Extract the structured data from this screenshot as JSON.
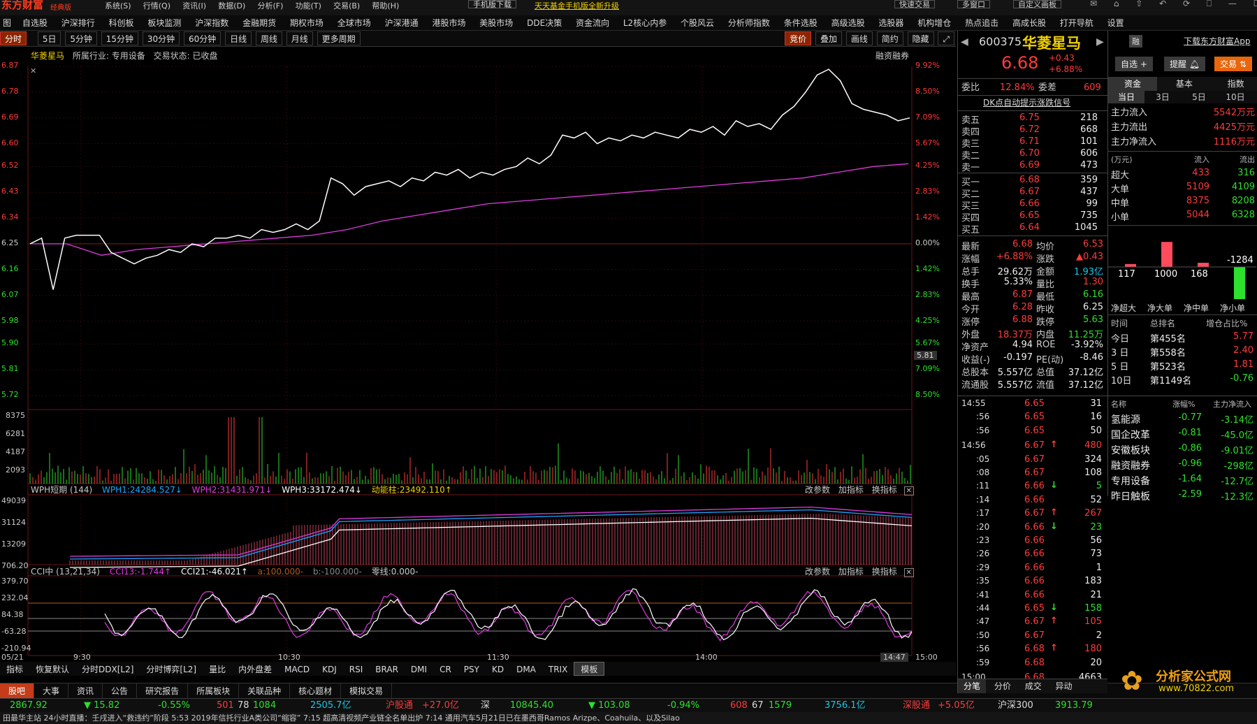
{
  "app": {
    "brand": "东方财富",
    "edition": "经典版",
    "menus": [
      "系统(S)",
      "行情(Q)",
      "资讯(I)",
      "数据(D)",
      "分析(F)",
      "功能(T)",
      "交易(B)",
      "帮助(H)"
    ],
    "promo1": "手机版下载",
    "promo2": "天天基金手机版全新升级",
    "right_items": [
      "快速交易",
      "多窗口",
      "自定义画板"
    ]
  },
  "nav": [
    "图",
    "自选股",
    "沪深排行",
    "科创板",
    "板块监测",
    "沪深指数",
    "金融期货",
    "期权市场",
    "全球市场",
    "沪深港通",
    "港股市场",
    "美股市场",
    "DDE决策",
    "资金流向",
    "L2核心内参",
    "个股风云",
    "分析师指数",
    "条件选股",
    "高级选股",
    "选股器",
    "机构增仓",
    "热点追击",
    "高成长股",
    "打开导航",
    "设置"
  ],
  "periods": [
    "分时",
    "5日",
    "5分钟",
    "15分钟",
    "30分钟",
    "60分钟",
    "日线",
    "周线",
    "月线",
    "更多周期"
  ],
  "chart_tools": [
    "竞价",
    "叠加",
    "画线",
    "简约",
    "隐藏"
  ],
  "stock_header": {
    "name": "华菱星马",
    "industry_label": "所属行业:",
    "industry": "专用设备",
    "state_label": "交易状态:",
    "state": "已收盘",
    "tag": "融资融券"
  },
  "axis": {
    "left": [
      "6.87",
      "6.78",
      "6.69",
      "6.60",
      "6.52",
      "6.43",
      "6.34",
      "6.25",
      "6.16",
      "6.07",
      "5.98",
      "5.90",
      "5.81",
      "5.72"
    ],
    "right": [
      "9.92%",
      "8.50%",
      "7.09%",
      "5.67%",
      "4.25%",
      "2.83%",
      "1.42%",
      "0.00%",
      "1.42%",
      "2.83%",
      "4.25%",
      "5.67%",
      "7.09%",
      "8.50%"
    ],
    "cursor_label": "5.81",
    "vol": [
      "8375",
      "6281",
      "4187",
      "2093"
    ],
    "wph": [
      "49039",
      "31124",
      "13209",
      "706.20"
    ],
    "cci": [
      "379.70",
      "232.04",
      "84.38",
      "-63.28",
      "-210.94"
    ],
    "time": [
      "05/21",
      "9:30",
      "10:30",
      "11:30",
      "14:00",
      "14:47",
      "15:00"
    ]
  },
  "wph": {
    "title": "WPH短期 (144)",
    "v1": "WPH1:24284.527↓",
    "v2": "WPH2:31431.971↓",
    "v3": "WPH3:33172.474↓",
    "v4": "动能柱:23492.110↑",
    "tools": [
      "改参数",
      "加指标",
      "换指标"
    ]
  },
  "cci": {
    "title": "CCI中 (13,21,34)",
    "v1": "CCI13:-1.744↑",
    "v2": "CCI21:-46.021↑",
    "v3": "a:100.000-",
    "v4": "b:-100.000-",
    "v5": "零线:0.000-",
    "tools": [
      "改参数",
      "加指标",
      "换指标"
    ]
  },
  "indicator_tabs": [
    "指标",
    "恢复默认",
    "分时DDX[L2]",
    "分时博弈[L2]",
    "量比",
    "内外盘差",
    "MACD",
    "KDJ",
    "RSI",
    "BRAR",
    "DMI",
    "CR",
    "PSY",
    "KD",
    "DMA",
    "TRIX",
    "模板"
  ],
  "bottom_tabs": [
    "股吧",
    "大事",
    "资讯",
    "公告",
    "研究报告",
    "所属板块",
    "关联品种",
    "核心题材",
    "模拟交易"
  ],
  "quote": {
    "code": "600375",
    "name": "华菱星马",
    "price": "6.68",
    "change": "+0.43",
    "pct": "+6.88%",
    "btn_watch": "自选 +",
    "btn_alert": "提醒",
    "btn_trade": "交易",
    "ratio_label": "委比",
    "ratio": "12.84%",
    "diff_label": "委差",
    "diff": "609",
    "signal": "DK点自动提示涨跌信号"
  },
  "order_book": {
    "sell": [
      [
        "卖五",
        "6.75",
        "218"
      ],
      [
        "卖四",
        "6.72",
        "668"
      ],
      [
        "卖三",
        "6.71",
        "101"
      ],
      [
        "卖二",
        "6.70",
        "606"
      ],
      [
        "卖一",
        "6.69",
        "473"
      ]
    ],
    "buy": [
      [
        "买一",
        "6.68",
        "359"
      ],
      [
        "买二",
        "6.67",
        "437"
      ],
      [
        "买三",
        "6.66",
        "99"
      ],
      [
        "买四",
        "6.65",
        "735"
      ],
      [
        "买五",
        "6.64",
        "1045"
      ]
    ]
  },
  "stats": [
    [
      "最新",
      "6.68",
      "均价",
      "6.53"
    ],
    [
      "涨幅",
      "+6.88%",
      "涨跌",
      "▲0.43"
    ],
    [
      "总手",
      "29.62万",
      "金额",
      "1.93亿"
    ],
    [
      "换手",
      "5.33%",
      "量比",
      "1.30"
    ],
    [
      "最高",
      "6.87",
      "最低",
      "6.16"
    ],
    [
      "今开",
      "6.28",
      "昨收",
      "6.25"
    ],
    [
      "涨停",
      "6.88",
      "跌停",
      "5.63"
    ],
    [
      "外盘",
      "18.37万",
      "内盘",
      "11.25万"
    ],
    [
      "净资产",
      "4.94",
      "ROE",
      "-3.92%"
    ],
    [
      "收益(-)",
      "-0.197",
      "PE(动)",
      "-8.46"
    ],
    [
      "总股本",
      "5.557亿",
      "总值",
      "37.12亿"
    ],
    [
      "流通股",
      "5.557亿",
      "流值",
      "37.12亿"
    ]
  ],
  "ticks": [
    [
      "14:55",
      "6.65",
      "31",
      ""
    ],
    [
      ":56",
      "6.65",
      "16",
      ""
    ],
    [
      ":56",
      "6.65",
      "50",
      ""
    ],
    [
      "14:56",
      "6.67",
      "480",
      "up"
    ],
    [
      ":05",
      "6.67",
      "324",
      ""
    ],
    [
      ":08",
      "6.67",
      "108",
      ""
    ],
    [
      ":11",
      "6.66",
      "5",
      "down"
    ],
    [
      ":14",
      "6.66",
      "52",
      ""
    ],
    [
      ":17",
      "6.67",
      "267",
      "up"
    ],
    [
      ":20",
      "6.66",
      "23",
      "down"
    ],
    [
      ":23",
      "6.66",
      "56",
      ""
    ],
    [
      ":26",
      "6.66",
      "73",
      ""
    ],
    [
      ":29",
      "6.66",
      "1",
      ""
    ],
    [
      ":35",
      "6.66",
      "183",
      ""
    ],
    [
      ":41",
      "6.66",
      "21",
      ""
    ],
    [
      ":44",
      "6.65",
      "158",
      "down"
    ],
    [
      ":47",
      "6.67",
      "105",
      "up"
    ],
    [
      ":50",
      "6.67",
      "2",
      ""
    ],
    [
      ":56",
      "6.68",
      "180",
      "up"
    ],
    [
      ":59",
      "6.68",
      "20",
      ""
    ],
    [
      "15:00",
      "6.68",
      "4663",
      ""
    ]
  ],
  "right_bottom_tabs": [
    "分笔",
    "分价",
    "成交",
    "异动"
  ],
  "fund": {
    "tabs": [
      "资金",
      "基本",
      "指数"
    ],
    "subtabs": [
      "当日",
      "3日",
      "5日",
      "10日"
    ],
    "flows": [
      [
        "主力流入",
        "5542万元"
      ],
      [
        "主力流出",
        "4425万元"
      ],
      [
        "主力净流入",
        "1116万元"
      ]
    ],
    "table_head": [
      "(万元)",
      "流入",
      "流出"
    ],
    "table": [
      [
        "超大",
        "433",
        "316"
      ],
      [
        "大单",
        "5109",
        "4109"
      ],
      [
        "中单",
        "8375",
        "8208"
      ],
      [
        "小单",
        "5044",
        "6328"
      ]
    ],
    "net_values": [
      "117",
      "1000",
      "168",
      "-1284"
    ],
    "net_labels": [
      "净超大",
      "净大单",
      "净中单",
      "净小单"
    ],
    "rank_head": [
      "时间",
      "总排名",
      "增仓占比%"
    ],
    "rank": [
      [
        "今日",
        "第455名",
        "5.77"
      ],
      [
        "3 日",
        "第558名",
        "2.40"
      ],
      [
        "5 日",
        "第523名",
        "1.81"
      ],
      [
        "10日",
        "第1149名",
        "-0.76"
      ]
    ],
    "sector_head": [
      "名称",
      "涨幅%",
      "主力净流入"
    ],
    "sectors": [
      [
        "氢能源",
        "-0.77",
        "-3.14亿"
      ],
      [
        "国企改革",
        "-0.81",
        "-45.0亿"
      ],
      [
        "安徽板块",
        "-0.86",
        "-9.01亿"
      ],
      [
        "融资融券",
        "-0.96",
        "-298亿"
      ],
      [
        "专用设备",
        "-1.64",
        "-12.7亿"
      ],
      [
        "昨日触板",
        "-2.59",
        "-12.3亿"
      ]
    ]
  },
  "top_right": {
    "download": "下载东方财富App",
    "badge": "融"
  },
  "status": {
    "idx1": "2867.92",
    "idx1_chg": "▼ 15.82",
    "idx1_pct": "-0.55%",
    "up": "501",
    "flat": "78",
    "down": "1084",
    "amt1": "2505.7亿",
    "hgt": "沪股通",
    "hgt_v": "+27.0亿",
    "sz": "深",
    "idx2": "10845.40",
    "idx2_chg": "▼ 103.08",
    "idx2_pct": "-0.94%",
    "up2": "608",
    "flat2": "67",
    "down2": "1579",
    "amt2": "3756.1亿",
    "sgt": "深股通",
    "sgt_v": "+5.05亿",
    "hs300": "沪深300",
    "hs300_v": "3913.79"
  },
  "ticker": "田最华主站   24小时直播：壬戌进入“救违约”阶段    5:53  2019年信托行业A类公司“缩容”    7:15  超高清视频产业链全名单出炉    7:14  通用汽车5月21日已在墨西哥Ramos Arizpe、Coahuila、以及Silao",
  "watermark": {
    "t1": "分析家公式网",
    "t2": "www.70822.com"
  },
  "chart_data": {
    "type": "line",
    "title": "华菱星马 分时",
    "prev_close": 6.25,
    "avg_end": 6.53,
    "x": [
      "9:30",
      "10:00",
      "10:30",
      "11:00",
      "11:30",
      "13:30",
      "14:00",
      "14:30",
      "15:00"
    ],
    "price": [
      6.26,
      6.19,
      6.28,
      6.34,
      6.5,
      6.57,
      6.65,
      6.7,
      6.68
    ],
    "avg": [
      6.25,
      6.23,
      6.31,
      6.38,
      6.42,
      6.45,
      6.47,
      6.51,
      6.53
    ],
    "price_points": [
      6.25,
      6.27,
      6.09,
      6.27,
      6.28,
      6.28,
      6.28,
      6.22,
      6.2,
      6.18,
      6.2,
      6.21,
      6.23,
      6.22,
      6.25,
      6.24,
      6.27,
      6.27,
      6.28,
      6.27,
      6.3,
      6.29,
      6.3,
      6.32,
      6.3,
      6.33,
      6.48,
      6.46,
      6.42,
      6.45,
      6.46,
      6.47,
      6.45,
      6.48,
      6.47,
      6.5,
      6.49,
      6.51,
      6.48,
      6.5,
      6.49,
      6.51,
      6.52,
      6.55,
      6.53,
      6.56,
      6.63,
      6.62,
      6.64,
      6.6,
      6.62,
      6.61,
      6.63,
      6.62,
      6.64,
      6.63,
      6.62,
      6.65,
      6.64,
      6.66,
      6.63,
      6.68,
      6.66,
      6.67,
      6.65,
      6.7,
      6.73,
      6.78,
      6.84,
      6.86,
      6.82,
      6.74,
      6.72,
      6.71,
      6.7,
      6.68,
      6.69
    ],
    "avg_points": [
      6.25,
      6.25,
      6.21,
      6.23,
      6.24,
      6.25,
      6.26,
      6.27,
      6.28,
      6.3,
      6.33,
      6.35,
      6.37,
      6.39,
      6.4,
      6.41,
      6.42,
      6.43,
      6.44,
      6.45,
      6.46,
      6.47,
      6.48,
      6.5,
      6.52,
      6.53
    ],
    "ylim": [
      5.72,
      6.87
    ]
  }
}
